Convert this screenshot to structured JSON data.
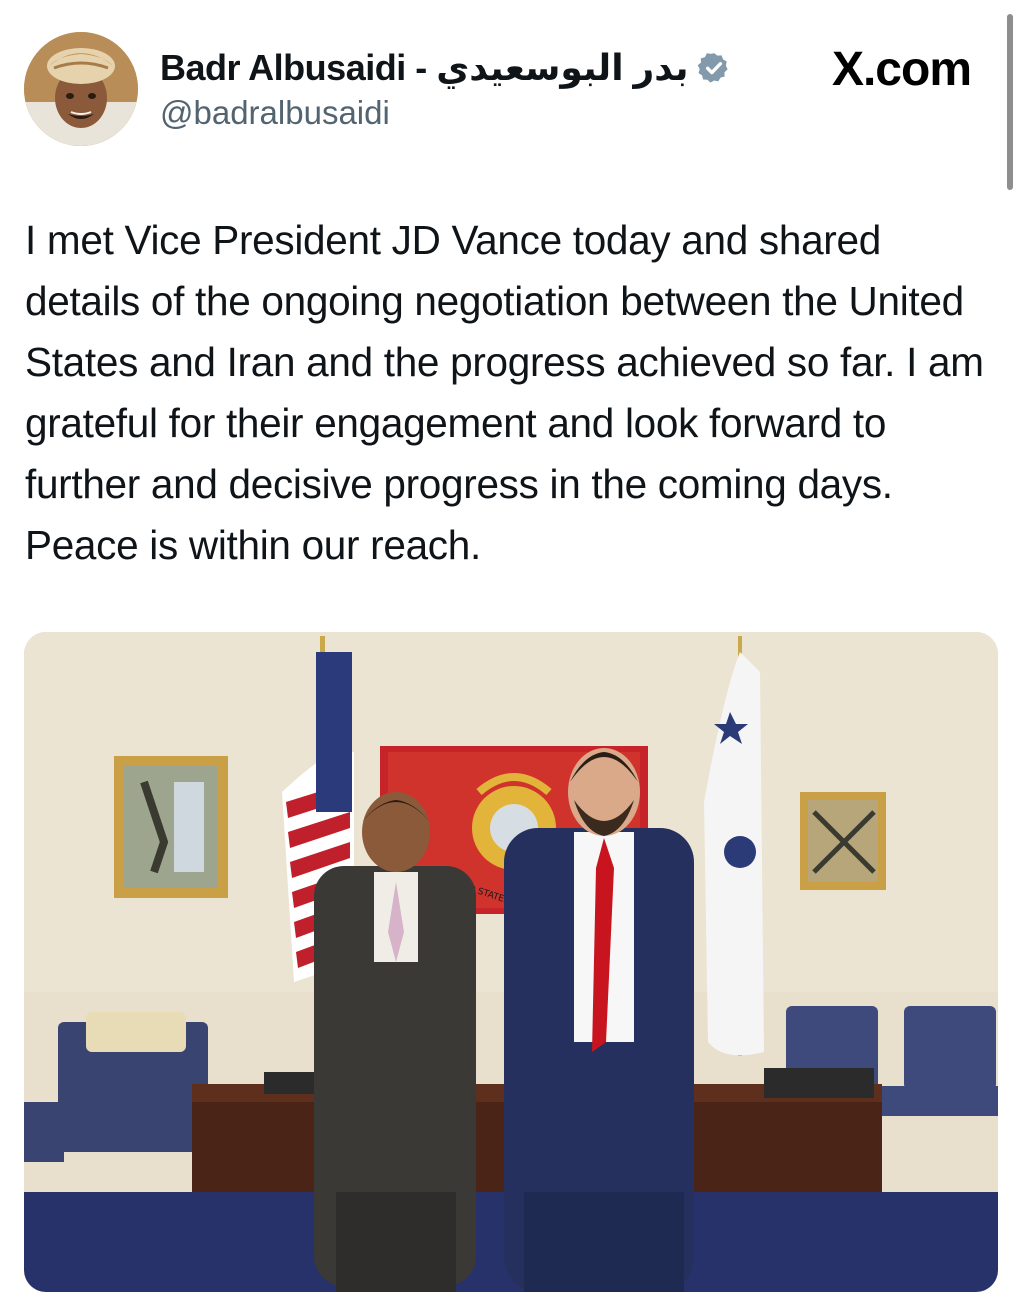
{
  "post": {
    "author": {
      "display_name": "Badr Albusaidi - بدر البوسعيدي",
      "handle": "@badralbusaidi",
      "verified": true,
      "avatar_icon": "profile-photo"
    },
    "site_label": "X.com",
    "text": "I met Vice President JD Vance today and shared details of the ongoing negotiation between the United States and Iran and the progress achieved so far. I am grateful for their engagement and look forward to further and decisive progress in the coming days. Peace is within our reach.",
    "media": {
      "type": "photo",
      "seal_text": "UNITED STATES"
    }
  },
  "colors": {
    "verified_badge": "#829aab",
    "handle_text": "#536471",
    "body_text": "#0f1419"
  }
}
